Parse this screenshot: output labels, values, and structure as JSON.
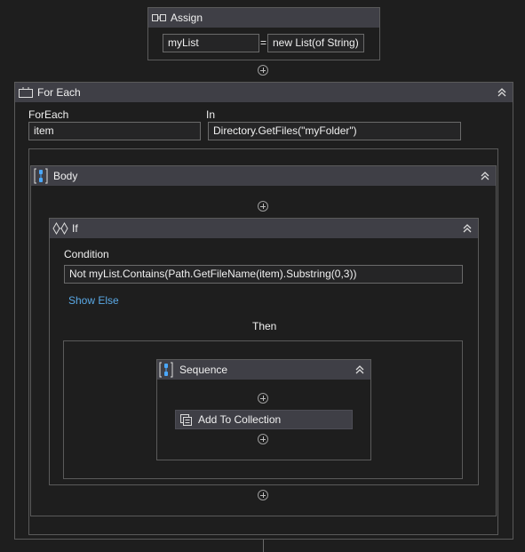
{
  "assign": {
    "title": "Assign",
    "to_value": "myList",
    "equals": "=",
    "value": "new List(of String)"
  },
  "foreach": {
    "title": "For Each",
    "foreach_label": "ForEach",
    "in_label": "In",
    "item_value": "item",
    "in_value": "Directory.GetFiles(\"myFolder\")"
  },
  "body": {
    "title": "Body"
  },
  "if_block": {
    "title": "If",
    "condition_label": "Condition",
    "condition_value": "Not myList.Contains(Path.GetFileName(item).Substring(0,3))",
    "show_else": "Show Else",
    "then_label": "Then"
  },
  "sequence": {
    "title": "Sequence",
    "activity": "Add To Collection"
  },
  "colors": {
    "background": "#1e1e1e",
    "header": "#3f3f46",
    "border": "#5a5a5a",
    "link": "#5aa9e6",
    "icon_accent": "#4aa8ff"
  }
}
